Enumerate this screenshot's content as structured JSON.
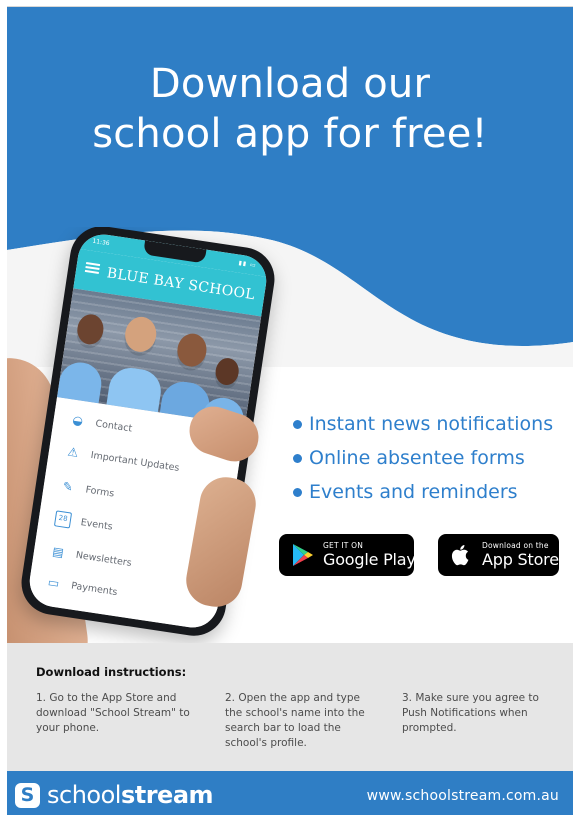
{
  "poster": {
    "headline_lines": [
      "Download our",
      "school app for free!"
    ],
    "features": [
      "Instant news notifications",
      "Online absentee forms",
      "Events and reminders"
    ],
    "colors": {
      "primary_blue": "#2f7ec5",
      "feature_blue": "#2e7fcc",
      "phone_header": "#32c2d2",
      "instructions_bg": "#e6e6e6"
    }
  },
  "phone": {
    "status_time": "11:36",
    "school_name": "BLUE BAY SCHOOL",
    "menu": [
      {
        "label": "Contact",
        "icon": "chat-bubble-icon"
      },
      {
        "label": "Important Updates",
        "icon": "warning-icon"
      },
      {
        "label": "Forms",
        "icon": "form-icon"
      },
      {
        "label": "Events",
        "icon": "calendar-icon",
        "icon_text": "28"
      },
      {
        "label": "Newsletters",
        "icon": "newsletter-icon"
      },
      {
        "label": "Payments",
        "icon": "credit-card-icon"
      }
    ]
  },
  "stores": {
    "google": {
      "small": "GET IT ON",
      "large": "Google Play",
      "icon": "google-play-icon"
    },
    "apple": {
      "small": "Download on the",
      "large": "App Store",
      "icon": "apple-icon"
    }
  },
  "instructions": {
    "heading": "Download instructions:",
    "steps": [
      "1. Go to the App Store and download \"School Stream\" to your phone.",
      "2. Open the app and type the school's name into the search bar to load the school's profile.",
      "3. Make sure you agree to Push Notifications when prompted."
    ]
  },
  "footer": {
    "brand_light": "school",
    "brand_bold": "stream",
    "logo_letter": "S",
    "url": "www.schoolstream.com.au"
  }
}
